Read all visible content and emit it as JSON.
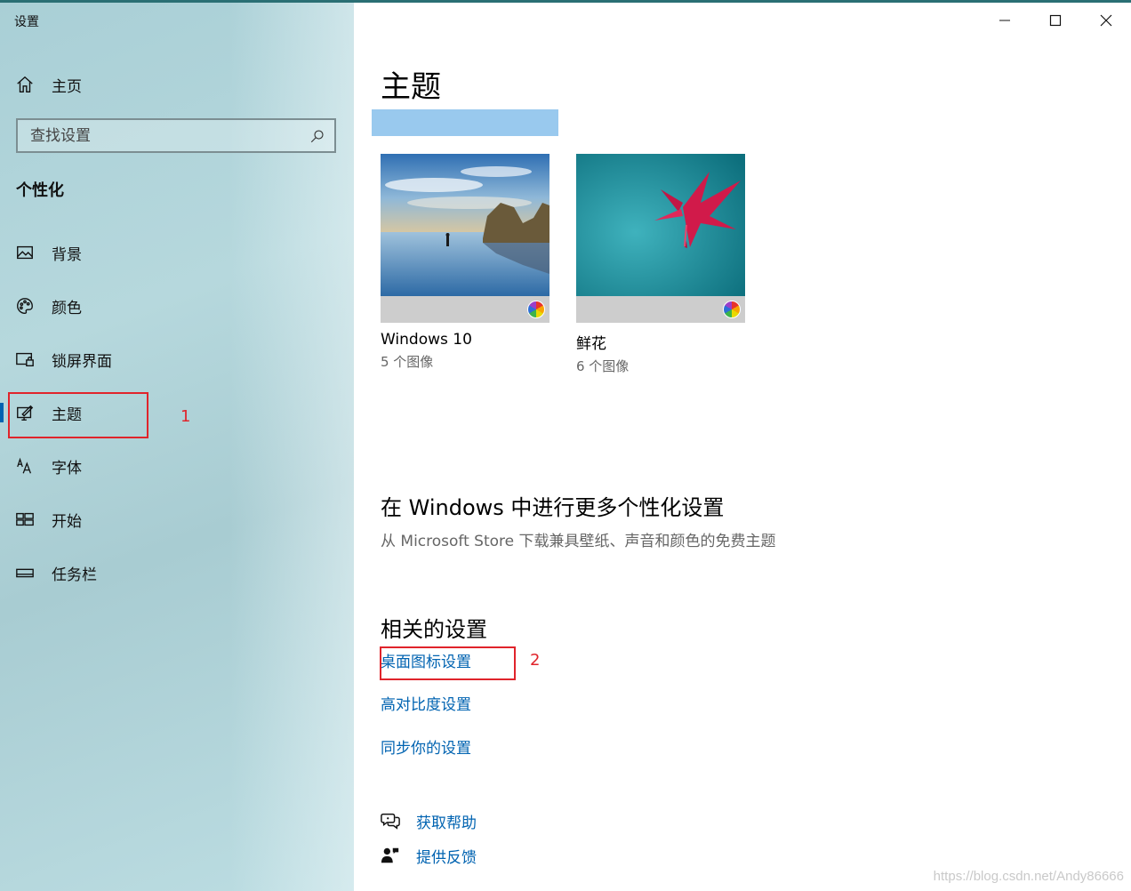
{
  "window": {
    "title": "设置",
    "controls": {
      "minimize": "minimize",
      "maximize": "maximize",
      "close": "close"
    }
  },
  "sidebar": {
    "home_label": "主页",
    "search": {
      "placeholder": "查找设置"
    },
    "section_title": "个性化",
    "items": [
      {
        "label": "背景",
        "icon": "picture-icon"
      },
      {
        "label": "颜色",
        "icon": "palette-icon"
      },
      {
        "label": "锁屏界面",
        "icon": "lock-screen-icon"
      },
      {
        "label": "主题",
        "icon": "theme-icon",
        "active": true
      },
      {
        "label": "字体",
        "icon": "font-icon"
      },
      {
        "label": "开始",
        "icon": "start-icon"
      },
      {
        "label": "任务栏",
        "icon": "taskbar-icon"
      }
    ],
    "annotation": "1"
  },
  "main": {
    "page_title": "主题",
    "themes": [
      {
        "name": "Windows 10",
        "count": "5 个图像"
      },
      {
        "name": "鲜花",
        "count": "6 个图像"
      }
    ],
    "more": {
      "title": "在 Windows 中进行更多个性化设置",
      "description": "从 Microsoft Store 下载兼具壁纸、声音和颜色的免费主题"
    },
    "related": {
      "title": "相关的设置",
      "links": [
        "桌面图标设置",
        "高对比度设置",
        "同步你的设置"
      ],
      "annotation": "2"
    },
    "help": {
      "get_help": "获取帮助",
      "feedback": "提供反馈"
    }
  },
  "watermark": "https://blog.csdn.net/Andy86666",
  "colors": {
    "accent": "#0063b1",
    "accent_light": "#99c9ee",
    "annotation_red": "#e0242b"
  }
}
